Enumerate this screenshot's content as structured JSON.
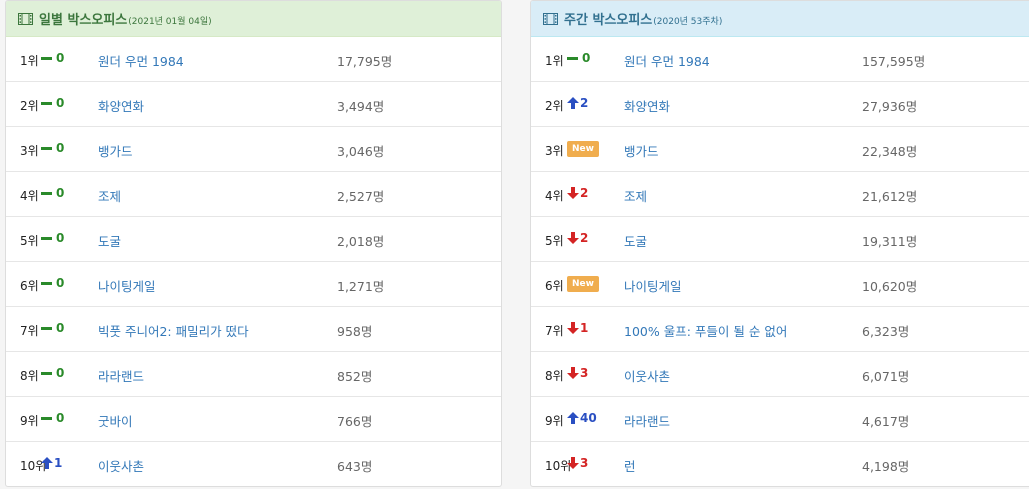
{
  "daily": {
    "title": "일별 박스오피스",
    "subtitle": "(2021년 01월 04일)",
    "rows": [
      {
        "rank": "1위",
        "change": "0",
        "dir": "same",
        "movie": "원더 우먼 1984",
        "audience": "17,795명"
      },
      {
        "rank": "2위",
        "change": "0",
        "dir": "same",
        "movie": "화양연화",
        "audience": "3,494명"
      },
      {
        "rank": "3위",
        "change": "0",
        "dir": "same",
        "movie": "뱅가드",
        "audience": "3,046명"
      },
      {
        "rank": "4위",
        "change": "0",
        "dir": "same",
        "movie": "조제",
        "audience": "2,527명"
      },
      {
        "rank": "5위",
        "change": "0",
        "dir": "same",
        "movie": "도굴",
        "audience": "2,018명"
      },
      {
        "rank": "6위",
        "change": "0",
        "dir": "same",
        "movie": "나이팅게일",
        "audience": "1,271명"
      },
      {
        "rank": "7위",
        "change": "0",
        "dir": "same",
        "movie": "빅풋 주니어2: 패밀리가 떴다",
        "audience": "958명"
      },
      {
        "rank": "8위",
        "change": "0",
        "dir": "same",
        "movie": "라라랜드",
        "audience": "852명"
      },
      {
        "rank": "9위",
        "change": "0",
        "dir": "same",
        "movie": "굿바이",
        "audience": "766명"
      },
      {
        "rank": "10위",
        "change": "1",
        "dir": "up",
        "movie": "이웃사촌",
        "audience": "643명"
      }
    ]
  },
  "weekly": {
    "title": "주간 박스오피스",
    "subtitle": "(2020년 53주차)",
    "rows": [
      {
        "rank": "1위",
        "change": "0",
        "dir": "same",
        "movie": "원더 우먼 1984",
        "audience": "157,595명"
      },
      {
        "rank": "2위",
        "change": "2",
        "dir": "up",
        "movie": "화양연화",
        "audience": "27,936명"
      },
      {
        "rank": "3위",
        "change": "New",
        "dir": "new",
        "movie": "뱅가드",
        "audience": "22,348명"
      },
      {
        "rank": "4위",
        "change": "2",
        "dir": "down",
        "movie": "조제",
        "audience": "21,612명"
      },
      {
        "rank": "5위",
        "change": "2",
        "dir": "down",
        "movie": "도굴",
        "audience": "19,311명"
      },
      {
        "rank": "6위",
        "change": "New",
        "dir": "new",
        "movie": "나이팅게일",
        "audience": "10,620명"
      },
      {
        "rank": "7위",
        "change": "1",
        "dir": "down",
        "movie": "100% 울프: 푸들이 될 순 없어",
        "audience": "6,323명"
      },
      {
        "rank": "8위",
        "change": "3",
        "dir": "down",
        "movie": "이웃사촌",
        "audience": "6,071명"
      },
      {
        "rank": "9위",
        "change": "40",
        "dir": "up",
        "movie": "라라랜드",
        "audience": "4,617명"
      },
      {
        "rank": "10위",
        "change": "3",
        "dir": "down",
        "movie": "런",
        "audience": "4,198명"
      }
    ]
  },
  "colors": {
    "same": "#2a8a2a",
    "up": "#2a4fc2",
    "down": "#d42424",
    "new_badge": "#f0ad4e",
    "link": "#3378b8",
    "daily_header_bg": "#dff0d8",
    "weekly_header_bg": "#d9edf7"
  },
  "icons": {
    "panel_header": "film-icon",
    "same": "dash-icon",
    "up": "arrow-up-icon",
    "down": "arrow-down-icon"
  }
}
